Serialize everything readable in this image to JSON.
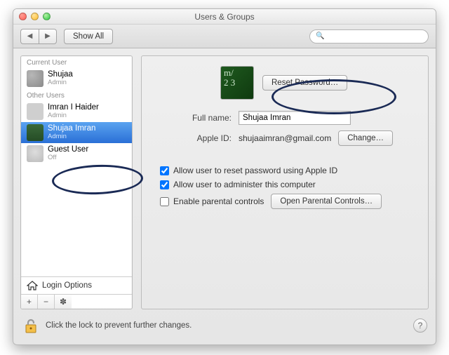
{
  "window": {
    "title": "Users & Groups"
  },
  "toolbar": {
    "show_all": "Show All",
    "search_placeholder": ""
  },
  "sidebar": {
    "section_current": "Current User",
    "section_other": "Other Users",
    "current": {
      "name": "Shujaa",
      "role": "Admin"
    },
    "others": [
      {
        "name": "Imran I Haider",
        "role": "Admin"
      },
      {
        "name": "Shujaa Imran",
        "role": "Admin"
      },
      {
        "name": "Guest User",
        "role": "Off"
      }
    ],
    "login_options": "Login Options"
  },
  "details": {
    "reset_password": "Reset Password…",
    "fullname_label": "Full name:",
    "fullname_value": "Shujaa Imran",
    "appleid_label": "Apple ID:",
    "appleid_value": "shujaaimran@gmail.com",
    "change": "Change…",
    "check_reset": "Allow user to reset password using Apple ID",
    "check_admin": "Allow user to administer this computer",
    "check_parental": "Enable parental controls",
    "open_parental": "Open Parental Controls…",
    "reset_checked": true,
    "admin_checked": true,
    "parental_checked": false
  },
  "footer": {
    "lock_text": "Click the lock to prevent further changes."
  }
}
